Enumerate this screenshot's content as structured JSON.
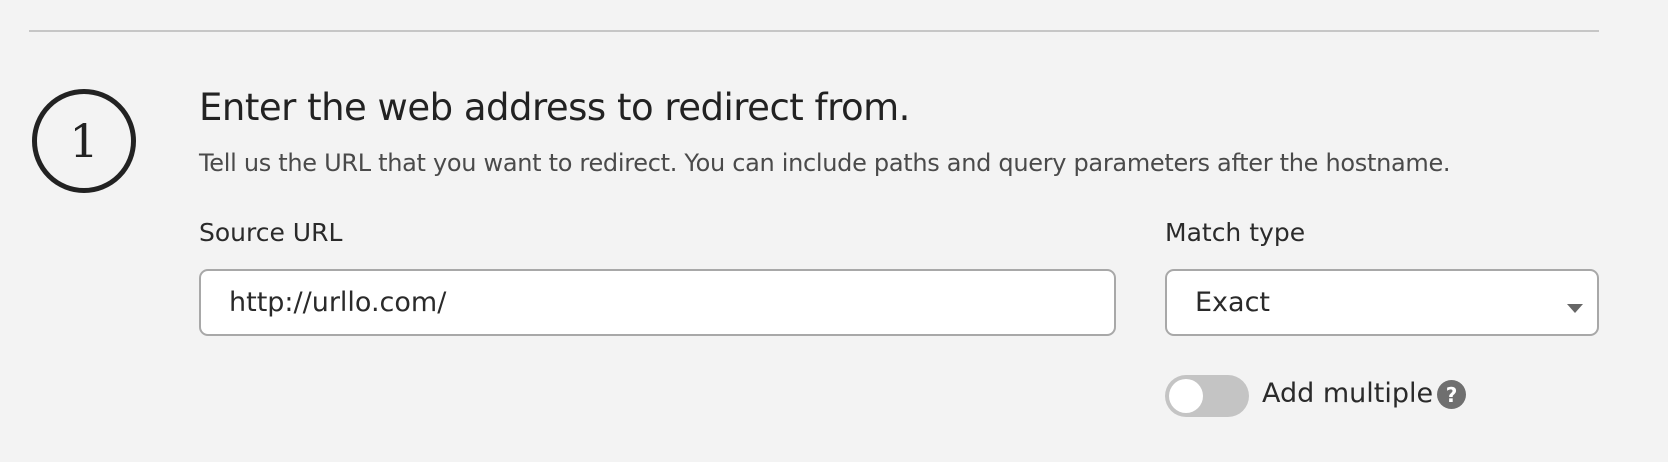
{
  "step": {
    "number": "1",
    "title": "Enter the web address to redirect from.",
    "description": "Tell us the URL that you want to redirect. You can include paths and query parameters after the hostname."
  },
  "source_url": {
    "label": "Source URL",
    "value": "http://urllo.com/"
  },
  "match_type": {
    "label": "Match type",
    "selected": "Exact"
  },
  "add_multiple": {
    "label": "Add multiple",
    "enabled": false,
    "help_icon": "question-circle-icon"
  },
  "colors": {
    "background": "#f3f3f3",
    "text": "#2a2a2a",
    "toggle_off": "#c4c4c4",
    "help_icon": "#6f6f6f"
  }
}
